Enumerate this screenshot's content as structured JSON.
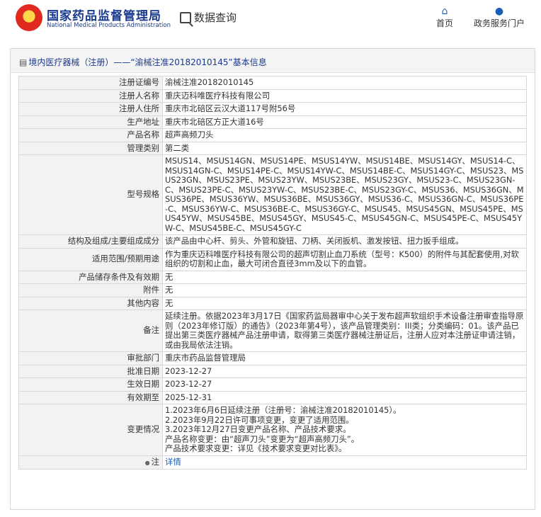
{
  "header": {
    "brand_cn": "国家药品监督管理局",
    "brand_en": "National Medical Products Administration",
    "query_label": "数据查询",
    "nav": [
      {
        "label": "首页",
        "icon": "home-icon"
      },
      {
        "label": "政务服务门户",
        "icon": "user-icon"
      }
    ]
  },
  "panel": {
    "title": "境内医疗器械（注册）——“渝械注准20182010145”基本信息"
  },
  "rows": [
    {
      "key": "注册证编号",
      "value": "渝械注准20182010145"
    },
    {
      "key": "注册人名称",
      "value": "重庆迈科唯医疗科技有限公司"
    },
    {
      "key": "注册人住所",
      "value": "重庆市北碚区云汉大道117号附56号"
    },
    {
      "key": "生产地址",
      "value": "重庆市北碚区方正大道16号"
    },
    {
      "key": "产品名称",
      "value": "超声高频刀头"
    },
    {
      "key": "管理类别",
      "value": "第二类"
    },
    {
      "key": "型号规格",
      "value": "MSUS14、MSUS14GN、MSUS14PE、MSUS14YW、MSUS14BE、MSUS14GY、MSUS14-C、MSUS14GN-C、MSUS14PE-C、MSUS14YW-C、MSUS14BE-C、MSUS14GY-C、MSUS23、MSUS23GN、MSUS23PE、MSUS23YW、MSUS23BE、MSUS23GY、MSUS23-C、MSUS23GN-C、MSUS23PE-C、MSUS23YW-C、MSUS23BE-C、MSUS23GY-C、MSUS36、MSUS36GN、MSUS36PE、MSUS36YW、MSUS36BE、MSUS36GY、MSUS36-C、MSUS36GN-C、MSUS36PE-C、MSUS36YW-C、MSUS36BE-C、MSUS36GY-C、MSUS45、MSUS45GN、MSUS45PE、MSUS45YW、MSUS45BE、MSUS45GY、MSUS45-C、MSUS45GN-C、MSUS45PE-C、MSUS45YW-C、MSUS45BE-C、MSUS45GY-C"
    },
    {
      "key": "结构及组成/主要组成成分",
      "value": "该产品由中心杆、剪头、外管和旋钮、刀柄、关闭扳机、激发按钮、扭力扳手组成。"
    },
    {
      "key": "适用范围/预期用途",
      "value": "作为重庆迈科唯医疗科技有限公司的超声切割止血刀系统（型号：K500）的附件与其配套使用,对软组织的切割和止血，最大可闭合直径3mm及以下的血管。"
    },
    {
      "key": "产品储存条件及有效期",
      "value": "无"
    },
    {
      "key": "附件",
      "value": "无"
    },
    {
      "key": "其他内容",
      "value": "无"
    },
    {
      "key": "备注",
      "value": "延续注册。依据2023年3月17日《国家药监局器审中心关于发布超声软组织手术设备注册审查指导原则（2023年修订版）的通告》（2023年第4号），该产品管理类别：III类；分类编码：01。该产品已提出第三类医疗器械产品注册申请，取得第三类医疗器械注册证后，注册人应对本注册证申请注销，或由我局依法注销。"
    },
    {
      "key": "审批部门",
      "value": "重庆市药品监督管理局"
    },
    {
      "key": "批准日期",
      "value": "2023-12-27"
    },
    {
      "key": "生效日期",
      "value": "2023-12-27"
    },
    {
      "key": "有效期至",
      "value": "2025-12-31"
    }
  ],
  "changes": {
    "key": "变更情况",
    "lines": [
      "1.2023年6月6日延续注册（注册号：渝械注准20182010145）。",
      "2.2023年9月22日许可事项变更，变更了适用范围。",
      "3.2023年12月27日变更产品名称、产品技术要求。",
      "产品名称变更：由“超声刀头”变更为“超声高频刀头”。",
      "产品技术要求变更：详见《技术要求变更对比表》。"
    ]
  },
  "note": {
    "key": "注",
    "icon": "lightbulb-icon",
    "link": "详情"
  }
}
